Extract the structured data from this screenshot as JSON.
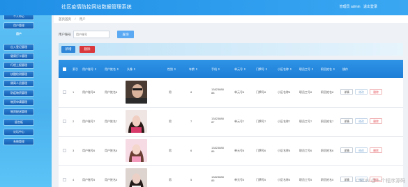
{
  "app": {
    "title": "社区疫情防控网站数据管理系统"
  },
  "user": {
    "welcome": "管理员 admin",
    "logout": "退出登录"
  },
  "sidebar": {
    "items": [
      {
        "label": "系统首页"
      },
      {
        "label": "个人中心"
      },
      {
        "label": "用户管理"
      },
      {
        "label": "用户"
      },
      {
        "label": "出入登记管理"
      },
      {
        "label": "健康打卡管理"
      },
      {
        "label": "行程上报管理"
      },
      {
        "label": "核酸检测管理"
      },
      {
        "label": "隔离人员管理"
      },
      {
        "label": "防疫物资管理"
      },
      {
        "label": "物资申请管理"
      },
      {
        "label": "物资配送管理"
      },
      {
        "label": "留言板"
      },
      {
        "label": "论坛中心"
      },
      {
        "label": "系统管理"
      }
    ]
  },
  "breadcrumb": {
    "home": "首页首页",
    "sep": "/",
    "current": "用户"
  },
  "search": {
    "label": "用户账号",
    "placeholder": "用户账号",
    "button": "查询"
  },
  "actions": {
    "add": "新增",
    "delete": "删除"
  },
  "table": {
    "headers": [
      "",
      "索引",
      "用户账号",
      "用户姓名",
      "头像",
      "性别",
      "年龄",
      "手机",
      "单元号",
      "门牌号",
      "小区名称",
      "职员工号",
      "职员姓名",
      "操作"
    ],
    "sort_mark": "⇕",
    "rows": [
      {
        "index": "1",
        "account": "用户账号8",
        "name": "用户姓名8",
        "gender": "男",
        "age": "8",
        "phone1": "13823888",
        "phone2": "88",
        "unit": "单元号8",
        "door": "门牌号8",
        "community": "小区名称8",
        "staff_no": "职员工号8",
        "staff_name": "职员姓名8"
      },
      {
        "index": "2",
        "account": "用户账号7",
        "name": "用户姓名7",
        "gender": "男",
        "age": "7",
        "phone1": "13823888",
        "phone2": "87",
        "unit": "单元号7",
        "door": "门牌号7",
        "community": "小区名称7",
        "staff_no": "职员工号7",
        "staff_name": "职员姓名7"
      },
      {
        "index": "3",
        "account": "用户账号6",
        "name": "用户姓名6",
        "gender": "男",
        "age": "6",
        "phone1": "13823888",
        "phone2": "86",
        "unit": "单元号6",
        "door": "门牌号6",
        "community": "小区名称6",
        "staff_no": "职员工号6",
        "staff_name": "职员姓名6"
      },
      {
        "index": "4",
        "account": "用户账号5",
        "name": "用户姓名5",
        "gender": "男",
        "age": "5",
        "phone1": "13823888",
        "phone2": "85",
        "unit": "单元号5",
        "door": "门牌号5",
        "community": "小区名称5",
        "staff_no": "职员工号5",
        "staff_name": "职员姓名5"
      }
    ],
    "row_actions": {
      "detail": "详情",
      "edit": "修改",
      "delete": "删除"
    }
  },
  "watermark": "CSDN @一个程序源码",
  "colors": {
    "header": "#1f8fe6",
    "sidebar": "#4ab1ee",
    "menu": "#1f6fc2",
    "add": "#2f86d8",
    "delete": "#d9373b"
  }
}
